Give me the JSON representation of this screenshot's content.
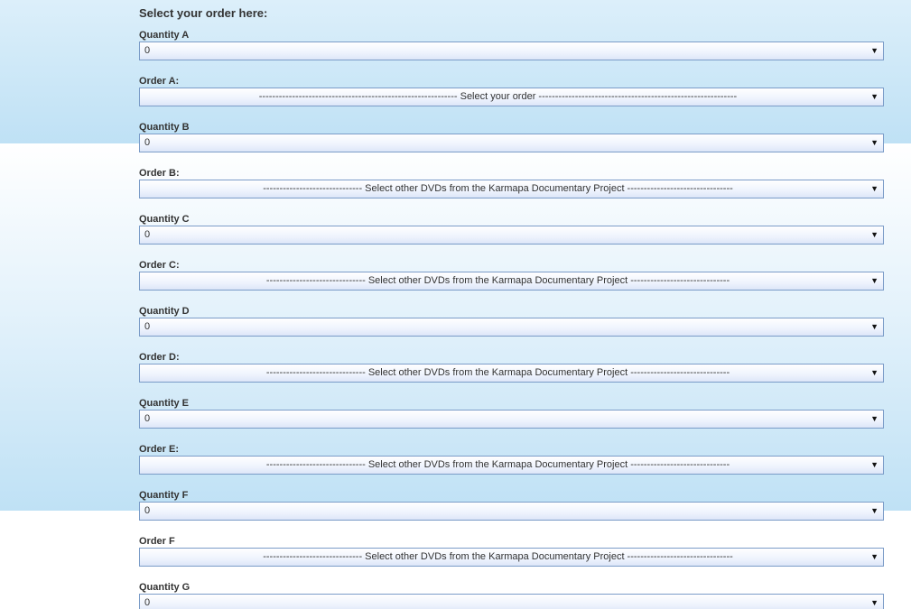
{
  "form": {
    "title": "Select your order here:",
    "fields": [
      {
        "label": "Quantity A",
        "value": "0"
      },
      {
        "label": "Order A:",
        "value": "------------------------------------------------------------ Select your order ------------------------------------------------------------"
      },
      {
        "label": "Quantity B",
        "value": "0"
      },
      {
        "label": "Order B:",
        "value": "------------------------------ Select other DVDs from the Karmapa Documentary Project --------------------------------"
      },
      {
        "label": "Quantity C",
        "value": "0"
      },
      {
        "label": "Order C:",
        "value": "------------------------------ Select other DVDs from the Karmapa Documentary Project ------------------------------"
      },
      {
        "label": "Quantity D",
        "value": "0"
      },
      {
        "label": "Order D:",
        "value": "------------------------------ Select other DVDs from the Karmapa Documentary Project ------------------------------"
      },
      {
        "label": "Quantity E",
        "value": "0"
      },
      {
        "label": "Order E:",
        "value": "------------------------------ Select other DVDs from the Karmapa Documentary Project ------------------------------"
      },
      {
        "label": "Quantity F",
        "value": "0"
      },
      {
        "label": "Order F",
        "value": "------------------------------ Select other DVDs from the Karmapa Documentary Project --------------------------------"
      },
      {
        "label": "Quantity G",
        "value": "0"
      }
    ]
  },
  "icons": {
    "dropdown_arrow": "chevron-down-icon",
    "dropdown_arrow_glyph": "▼"
  },
  "colors": {
    "background_band": "#bfe1f5",
    "select_border": "#7b9cc8",
    "text": "#333333"
  }
}
